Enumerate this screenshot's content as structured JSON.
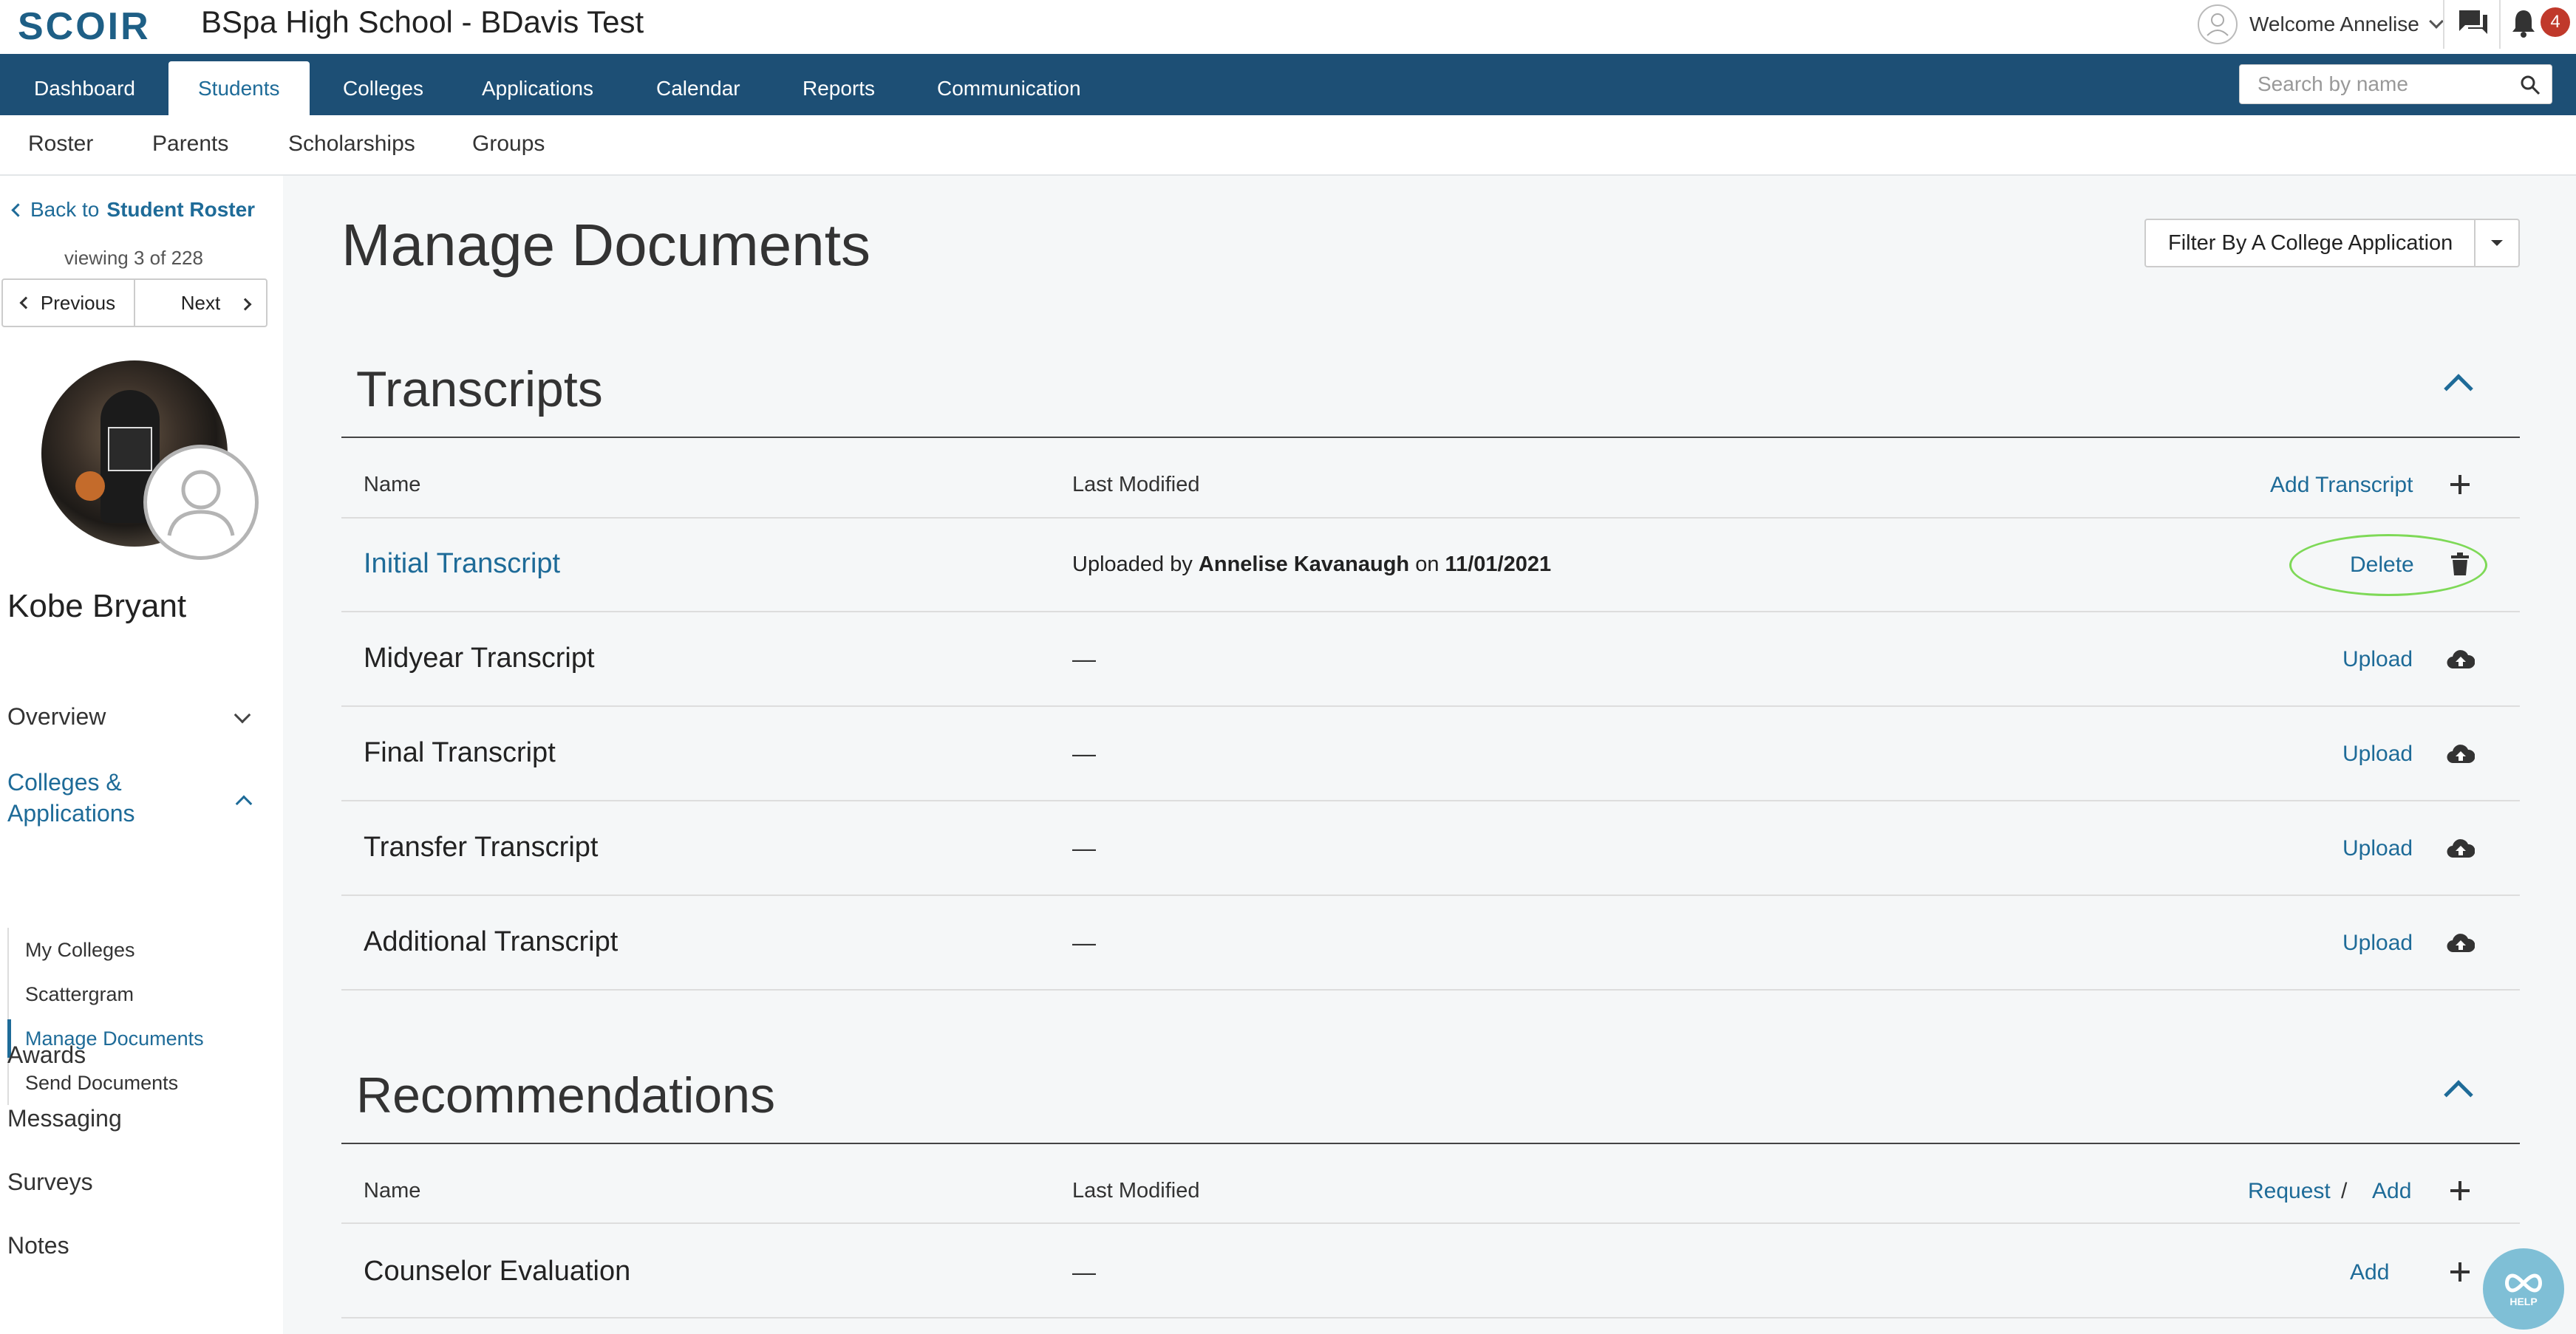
{
  "header": {
    "logo": "SCOIR",
    "school_name": "BSpa High School - BDavis Test",
    "welcome": "Welcome Annelise",
    "notification_count": "4"
  },
  "main_nav": {
    "tabs": [
      {
        "label": "Dashboard",
        "active": false
      },
      {
        "label": "Students",
        "active": true
      },
      {
        "label": "Colleges",
        "active": false
      },
      {
        "label": "Applications",
        "active": false
      },
      {
        "label": "Calendar",
        "active": false
      },
      {
        "label": "Reports",
        "active": false
      },
      {
        "label": "Communication",
        "active": false
      }
    ],
    "search_placeholder": "Search by name"
  },
  "sub_nav": {
    "tabs": [
      "Roster",
      "Parents",
      "Scholarships",
      "Groups"
    ]
  },
  "sidebar": {
    "back_prefix": "Back to",
    "back_target": "Student Roster",
    "viewing": "viewing 3 of 228",
    "prev_label": "Previous",
    "next_label": "Next",
    "student_name": "Kobe Bryant",
    "overview": "Overview",
    "colleges_apps": "Colleges & Applications",
    "sub_items": [
      "My Colleges",
      "Scattergram",
      "Manage Documents",
      "Send Documents"
    ],
    "active_sub": "Manage Documents",
    "awards": "Awards",
    "messaging": "Messaging",
    "surveys": "Surveys",
    "notes": "Notes"
  },
  "main": {
    "title": "Manage Documents",
    "filter_label": "Filter By A College Application",
    "transcripts": {
      "title": "Transcripts",
      "col_name": "Name",
      "col_modified": "Last Modified",
      "add_label": "Add Transcript",
      "rows": [
        {
          "name": "Initial Transcript",
          "uploaded_prefix": "Uploaded by",
          "uploader": "Annelise Kavanaugh",
          "on": "on",
          "date": "11/01/2021",
          "action": "Delete"
        },
        {
          "name": "Midyear Transcript",
          "modified": "—",
          "action": "Upload"
        },
        {
          "name": "Final Transcript",
          "modified": "—",
          "action": "Upload"
        },
        {
          "name": "Transfer Transcript",
          "modified": "—",
          "action": "Upload"
        },
        {
          "name": "Additional Transcript",
          "modified": "—",
          "action": "Upload"
        }
      ]
    },
    "recommendations": {
      "title": "Recommendations",
      "col_name": "Name",
      "col_modified": "Last Modified",
      "request_label": "Request",
      "slash": "/",
      "add_label": "Add",
      "rows": [
        {
          "name": "Counselor Evaluation",
          "modified": "—",
          "action": "Add"
        }
      ]
    }
  },
  "help_label": "HELP",
  "colors": {
    "nav_bg": "#1d4f75",
    "accent": "#1e6b98",
    "highlight": "#7ed957",
    "badge": "#c0392b"
  }
}
